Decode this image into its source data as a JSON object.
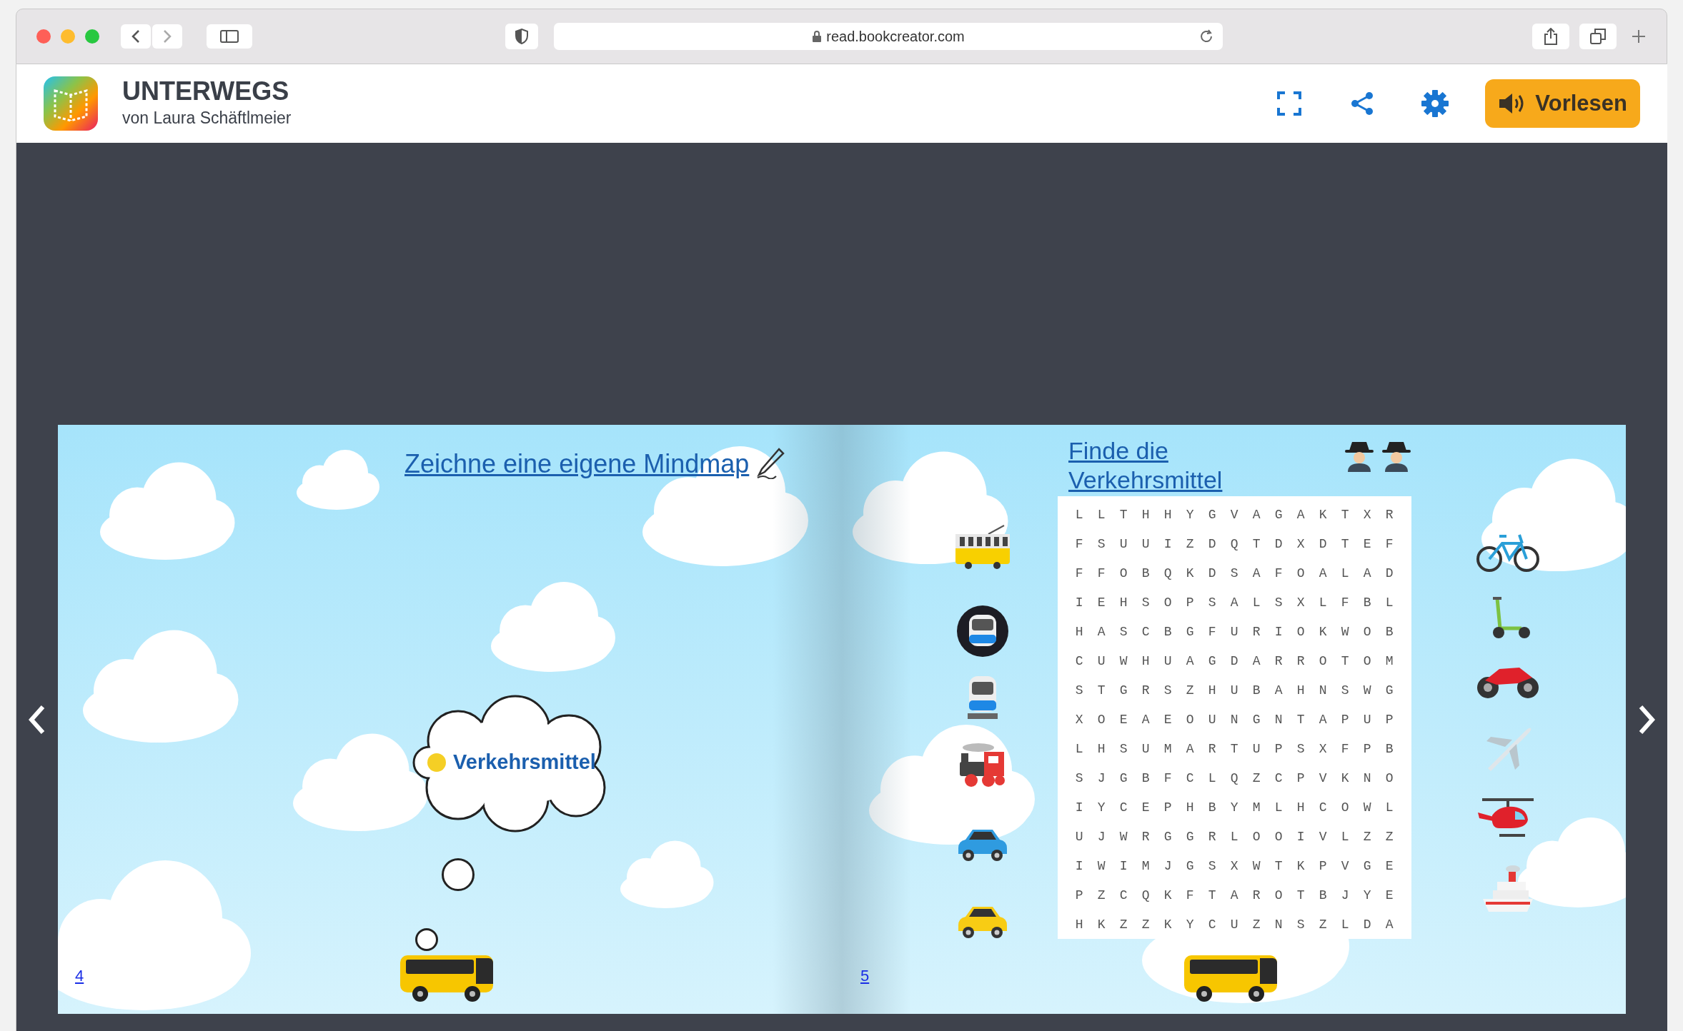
{
  "browser": {
    "url": "read.bookcreator.com"
  },
  "header": {
    "title": "UNTERWEGS",
    "author": "von Laura Schäftlmeier",
    "read_aloud_button": "Vorlesen"
  },
  "book": {
    "left_page": {
      "title": "Zeichne eine eigene Mindmap",
      "thought": "Verkehrsmittel",
      "page_number": "4"
    },
    "right_page": {
      "title": "Finde die Verkehrsmittel",
      "page_number": "5",
      "grid_rows": [
        "L L T H H Y G V A G A K T X R",
        "F S U U I Z D Q T D X D T E F",
        "F F O B Q K D S A F O A L A D",
        "I E H S O P S A L S X L F B L",
        "H A S C B G F U R I O K W O B",
        "C U W H U A G D A R R O T O M",
        "S T G R S Z H U B A H N S W G",
        "X O E A E O U N G N T A P U P",
        "L H S U M A R T U P S X F P B",
        "S J G B F C L Q Z C P V K N O",
        "I Y C E P H B Y M L H C O W L",
        "U J W R G G R L O O I V L Z Z",
        "I W I M J G S X W T K P V G E",
        "P Z C Q K F T A R O T B J Y E",
        "H K Z Z K Y C U Z N S Z L D A"
      ]
    }
  }
}
